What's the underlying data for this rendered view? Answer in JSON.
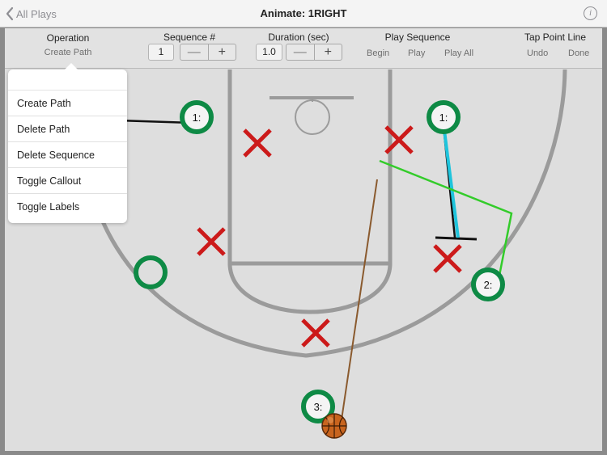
{
  "nav": {
    "back_label": "All Plays",
    "title": "Animate: 1RIGHT",
    "info_glyph": "i"
  },
  "toolbar": {
    "operation": {
      "label": "Operation",
      "value": "Create Path"
    },
    "sequence": {
      "label": "Sequence #",
      "value": "1",
      "minus": "—",
      "plus": "+"
    },
    "duration": {
      "label": "Duration (sec)",
      "value": "1.0",
      "minus": "—",
      "plus": "+"
    },
    "play_sequence": {
      "label": "Play Sequence",
      "begin": "Begin",
      "play": "Play",
      "play_all": "Play All"
    },
    "tap_point_line": {
      "label": "Tap Point Line",
      "undo": "Undo",
      "done": "Done"
    }
  },
  "menu": {
    "items": [
      {
        "label": "Create Path"
      },
      {
        "label": "Delete Path"
      },
      {
        "label": "Delete Sequence"
      },
      {
        "label": "Toggle Callout"
      },
      {
        "label": "Toggle Labels"
      }
    ]
  },
  "court": {
    "offense_players": [
      {
        "label": "1:"
      },
      {
        "label": "1:"
      },
      {
        "label": "2:"
      },
      {
        "label": "3:"
      },
      {
        "label": ""
      }
    ],
    "colors": {
      "offense": "#0e8a45",
      "defense": "#cc1a1a",
      "pass": "#1fc4dc",
      "cut": "#33cc2a",
      "dribble": "#8a5a2e",
      "screen": "#111111",
      "court_line": "#9b9b9b"
    }
  }
}
